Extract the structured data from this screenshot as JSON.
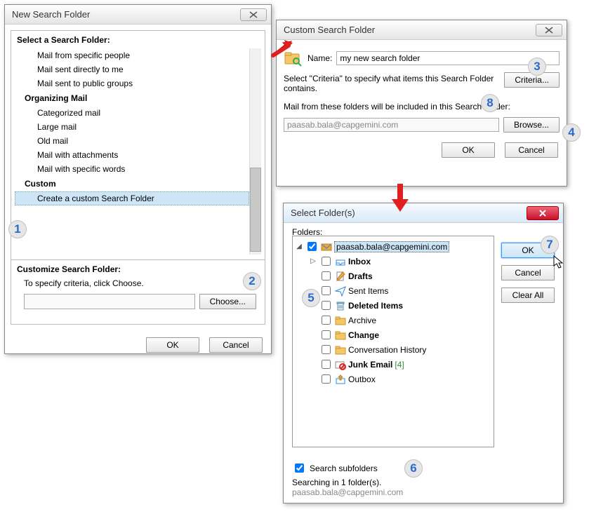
{
  "dlg1": {
    "title": "New Search Folder",
    "section": "Select a Search Folder:",
    "groups": {
      "g1_items": [
        "Mail from specific people",
        "Mail sent directly to me",
        "Mail sent to public groups"
      ],
      "g2_label": "Organizing Mail",
      "g2_items": [
        "Categorized mail",
        "Large mail",
        "Old mail",
        "Mail with attachments",
        "Mail with specific words"
      ],
      "g3_label": "Custom",
      "g3_items": [
        "Create a custom Search Folder"
      ]
    },
    "customize_label": "Customize Search Folder:",
    "instruction": "To specify criteria, click Choose.",
    "choose": "Choose...",
    "ok": "OK",
    "cancel": "Cancel"
  },
  "dlg2": {
    "title": "Custom Search Folder",
    "name_label": "Name:",
    "name_value": "my new search folder",
    "criteria_text": "Select \"Criteria\" to specify what items this Search Folder contains.",
    "criteria_btn": "Criteria...",
    "include_label": "Mail from these folders will be included in this Search Folder:",
    "folder_value": "paasab.bala@capgemini.com",
    "browse_btn": "Browse...",
    "ok": "OK",
    "cancel": "Cancel"
  },
  "dlg3": {
    "title": "Select Folder(s)",
    "folders_label": "Folders:",
    "root": "paasab.bala@capgemini.com",
    "items": [
      {
        "label": "Inbox",
        "bold": true,
        "icon": "inbox"
      },
      {
        "label": "Drafts",
        "bold": true,
        "icon": "drafts"
      },
      {
        "label": "Sent Items",
        "bold": false,
        "icon": "sent"
      },
      {
        "label": "Deleted Items",
        "bold": true,
        "icon": "trash"
      },
      {
        "label": "Archive",
        "bold": false,
        "icon": "folder"
      },
      {
        "label": "Change",
        "bold": true,
        "icon": "folder"
      },
      {
        "label": "Conversation History",
        "bold": false,
        "icon": "folder"
      },
      {
        "label": "Junk Email",
        "bold": true,
        "icon": "junk",
        "suffix": "[4]"
      },
      {
        "label": "Outbox",
        "bold": false,
        "icon": "outbox"
      }
    ],
    "subfolders_label": "Search subfolders",
    "status1": "Searching in 1 folder(s).",
    "status2": "paasab.bala@capgemini.com",
    "ok": "OK",
    "cancel": "Cancel",
    "clear": "Clear All"
  },
  "annotations": {
    "a1": "1",
    "a2": "2",
    "a3": "3",
    "a4": "4",
    "a5": "5",
    "a6": "6",
    "a7": "7",
    "a8": "8"
  }
}
